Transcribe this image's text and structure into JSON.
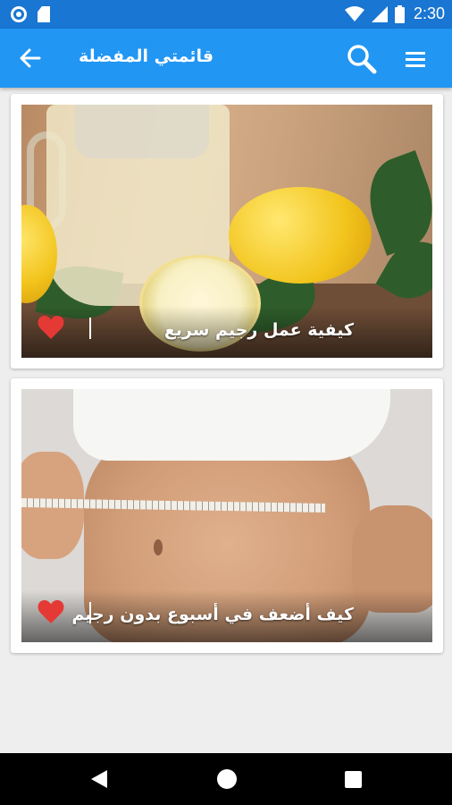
{
  "status_bar": {
    "time": "2:30",
    "icons": [
      "camera-circle-icon",
      "sd-card-icon",
      "wifi-icon",
      "signal-icon",
      "battery-icon"
    ]
  },
  "app_bar": {
    "title": "قائمتي المفضلة",
    "icons": [
      "back-arrow-icon",
      "search-icon",
      "hamburger-menu-icon"
    ]
  },
  "favorites": [
    {
      "title": "كيفية عمل رجيم سريع",
      "image": "lemon-juice-pitcher-image",
      "favorited": true
    },
    {
      "title": "كيف أضعف في أسبوع بدون رجيم",
      "image": "waist-measuring-tape-image",
      "favorited": true
    }
  ],
  "nav_bar": {
    "icons": [
      "nav-back-icon",
      "nav-home-icon",
      "nav-recents-icon"
    ]
  },
  "colors": {
    "app_bar": "#2196f3",
    "status_bar": "#1976d2",
    "heart": "#e53935",
    "background": "#eeeeee"
  }
}
